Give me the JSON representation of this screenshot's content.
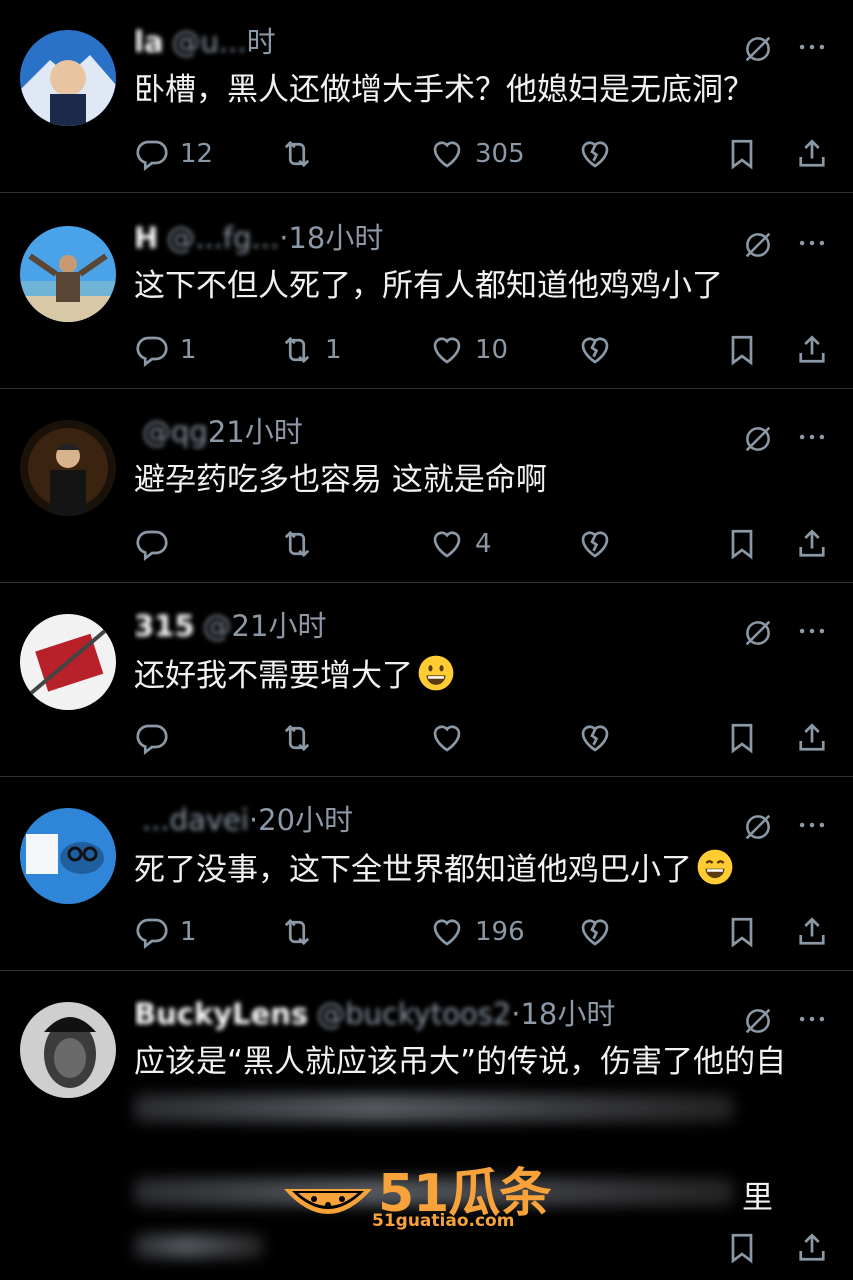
{
  "tweets": [
    {
      "name": "la",
      "handle": "@u...",
      "time": "时",
      "text": "卧槽，黑人还做增大手术？他媳妇是无底洞？",
      "emoji": "",
      "reply": "12",
      "retweet": "",
      "like": "305"
    },
    {
      "name": "H",
      "handle": "@...fg...",
      "time": "·18小时",
      "text": "这下不但人死了，所有人都知道他鸡鸡小了",
      "emoji": "",
      "reply": "1",
      "retweet": "1",
      "like": "10"
    },
    {
      "name": "",
      "handle": "@qg",
      "time": "21小时",
      "text": "避孕药吃多也容易 这就是命啊",
      "emoji": "",
      "reply": "",
      "retweet": "",
      "like": "4"
    },
    {
      "name": "315",
      "handle": "@",
      "time": "21小时",
      "text": "还好我不需要增大了",
      "emoji": "grinning-face",
      "reply": "",
      "retweet": "",
      "like": ""
    },
    {
      "name": "",
      "handle": "...davei",
      "time": "·20小时",
      "text": "死了没事，这下全世界都知道他鸡巴小了",
      "emoji": "smiling-face-with-open-mouth",
      "reply": "1",
      "retweet": "",
      "like": "196"
    },
    {
      "name": "BuckyLens",
      "handle": "@buckytoos2",
      "time": "·18小时",
      "text": "应该是“黑人就应该吊大”的传说，伤害了他的自",
      "emoji": "",
      "reply": "",
      "retweet": "",
      "like": ""
    }
  ],
  "partial_text": "里",
  "watermark": {
    "title": "51瓜条",
    "url": "51guatiao.com"
  },
  "colors": {
    "background": "#000000",
    "text": "#e7e9ea",
    "muted": "#8b98a5",
    "divider": "#2f3336",
    "verified": "#1d9bf0",
    "watermark": "#f7a23a"
  }
}
